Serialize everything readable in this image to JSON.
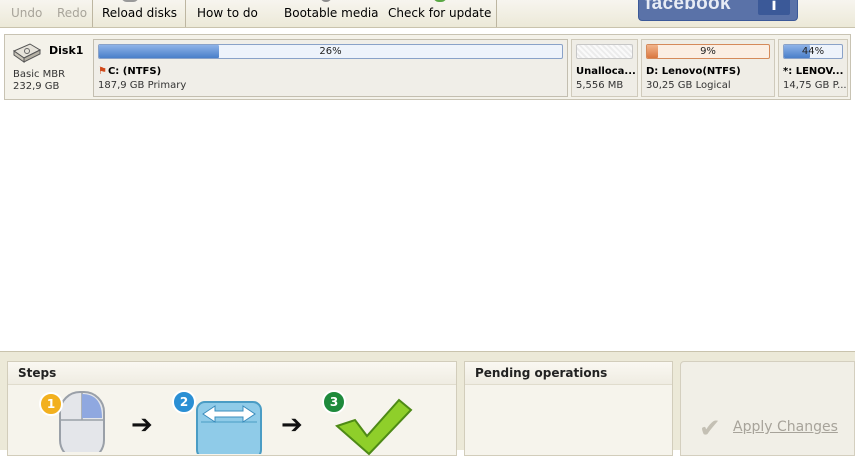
{
  "toolbar": {
    "undo_label": "Undo",
    "redo_label": "Redo",
    "reload_label": "Reload disks",
    "howto_label": "How to do",
    "bootable_label": "Bootable media",
    "update_label": "Check for update",
    "facebook_text": "facebook",
    "facebook_like_glyph": "i"
  },
  "disk": {
    "name": "Disk1",
    "type": "Basic MBR",
    "size": "232,9 GB",
    "partitions": [
      {
        "name": "C: (NTFS)",
        "sub": "187,9 GB Primary",
        "usage_percent": 26,
        "usage_label": "26%",
        "kind": "system"
      },
      {
        "name": "Unalloca...",
        "sub": "5,556 MB",
        "kind": "unallocated"
      },
      {
        "name": "D: Lenovo(NTFS)",
        "sub": "30,25 GB Logical",
        "usage_percent": 9,
        "usage_label": "9%",
        "kind": "logical"
      },
      {
        "name": "*: LENOV...",
        "sub": "14,75 GB P...",
        "usage_percent": 44,
        "usage_label": "44%",
        "kind": "other"
      }
    ]
  },
  "steps": {
    "title": "Steps",
    "badges": [
      "1",
      "2",
      "3"
    ]
  },
  "pending": {
    "title": "Pending operations"
  },
  "apply": {
    "label": "Apply Changes"
  },
  "colors": {
    "facebook": "#3b5998",
    "bar_blue": "#4a7fc9",
    "bar_orange": "#d9773f",
    "badge1": "#f2b01e",
    "badge2": "#2a8fd4",
    "badge3": "#1e8a3c"
  }
}
